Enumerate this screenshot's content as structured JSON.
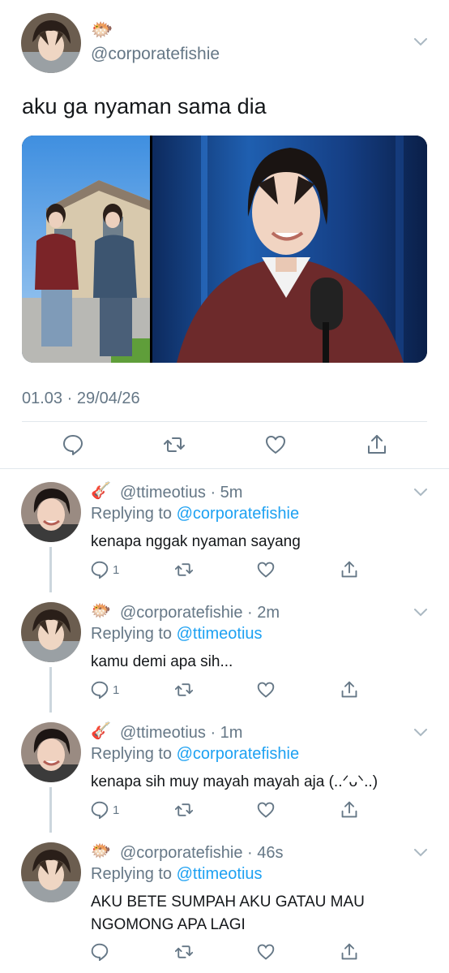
{
  "main_tweet": {
    "emoji": "🐡",
    "handle": "@corporatefishie",
    "text": "aku ga nyaman sama dia",
    "timestamp": "01.03 · 29/04/26",
    "icons": {
      "avatar": "avatar-photo",
      "menu": "chevron-down-icon",
      "reply": "reply-icon",
      "retweet": "retweet-icon",
      "like": "heart-icon",
      "share": "share-icon"
    }
  },
  "replies": [
    {
      "emoji": "🎸",
      "handle": "@ttimeotius",
      "time": "5m",
      "replying_label": "Replying to",
      "replying_to": "@corporatefishie",
      "text": "kenapa nggak nyaman sayang",
      "reply_count": "1"
    },
    {
      "emoji": "🐡",
      "handle": "@corporatefishie",
      "time": "2m",
      "replying_label": "Replying to",
      "replying_to": "@ttimeotius",
      "text": "kamu demi apa sih...",
      "reply_count": "1"
    },
    {
      "emoji": "🎸",
      "handle": "@ttimeotius",
      "time": "1m",
      "replying_label": "Replying to",
      "replying_to": "@corporatefishie",
      "text": "kenapa sih muy mayah mayah aja (..ᐟᴗᐠ..)",
      "reply_count": "1"
    },
    {
      "emoji": "🐡",
      "handle": "@corporatefishie",
      "time": "46s",
      "replying_label": "Replying to",
      "replying_to": "@ttimeotius",
      "text": "AKU BETE SUMPAH AKU GATAU MAU NGOMONG APA LAGI",
      "reply_count": ""
    }
  ],
  "colors": {
    "text": "#14171a",
    "secondary": "#657786",
    "link": "#1da1f2",
    "divider": "#e1e8ed",
    "thread_line": "#ccd6dd"
  }
}
